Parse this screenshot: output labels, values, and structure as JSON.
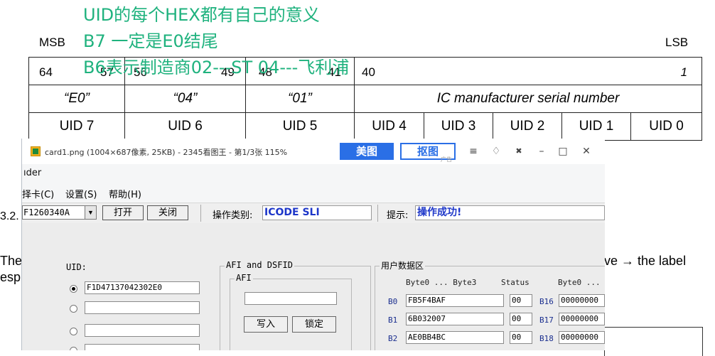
{
  "notes": [
    "UID的每个HEX都有自己的意义",
    "B7 一定是E0结尾",
    "B6表示制造商02---ST   04---飞利浦"
  ],
  "doc": {
    "msb": "MSB",
    "lsb": "LSB",
    "bits": [
      "64",
      "57",
      "56",
      "49",
      "48",
      "41",
      "40",
      "1"
    ],
    "row2": [
      "“E0”",
      "“04”",
      "“01”",
      "IC manufacturer serial number"
    ],
    "row3": [
      "UID 7",
      "UID 6",
      "UID 5",
      "UID 4",
      "UID 3",
      "UID 2",
      "UID 1",
      "UID 0"
    ],
    "frag_section": "3.2.",
    "frag_left1": "The",
    "frag_left2": "esp",
    "frag_right": "ive → the label"
  },
  "viewer": {
    "title": "card1.png (1004×687像素, 25KB) - 2345看图王 - 第1/3张 115%",
    "meitu_label": "美图",
    "koutu_label": "抠图",
    "ad_label": "广告",
    "icons": [
      "menu-icon",
      "skin-icon",
      "shrink-icon",
      "minimize-icon",
      "maximize-icon",
      "close-icon"
    ],
    "icon_glyphs": [
      "≡",
      "♢",
      "✖",
      "–",
      "□",
      "✕"
    ]
  },
  "app": {
    "title": "ıder",
    "menu": [
      "择卡(C)",
      "设置(S)",
      "帮助(H)"
    ],
    "device_value": "F1260340A",
    "open_button": "打开",
    "close_button": "关闭",
    "op_type_label": "操作类别:",
    "op_type_value": "ICODE SLI",
    "hint_label": "提示:",
    "hint_value": "操作成功!",
    "uid_group": {
      "title": "UID:",
      "entries": [
        "F1D47137042302E0",
        "",
        "",
        ""
      ]
    },
    "afi_group": {
      "title": "AFI and DSFID",
      "afi_title": "AFI",
      "afi_value": "",
      "write_button": "写入",
      "lock_button": "锁定"
    },
    "user_data": {
      "title": "用户数据区",
      "col_bytes": "Byte0 ... Byte3",
      "col_status": "Status",
      "col_bytes2": "Byte0 ...",
      "rows": [
        {
          "block": "B0",
          "data": "FB5F4BAF",
          "status": "00",
          "block2": "B16",
          "data2": "00000000"
        },
        {
          "block": "B1",
          "data": "6B032007",
          "status": "00",
          "block2": "B17",
          "data2": "00000000"
        },
        {
          "block": "B2",
          "data": "AE0BB4BC",
          "status": "00",
          "block2": "B18",
          "data2": "00000000"
        }
      ]
    }
  }
}
